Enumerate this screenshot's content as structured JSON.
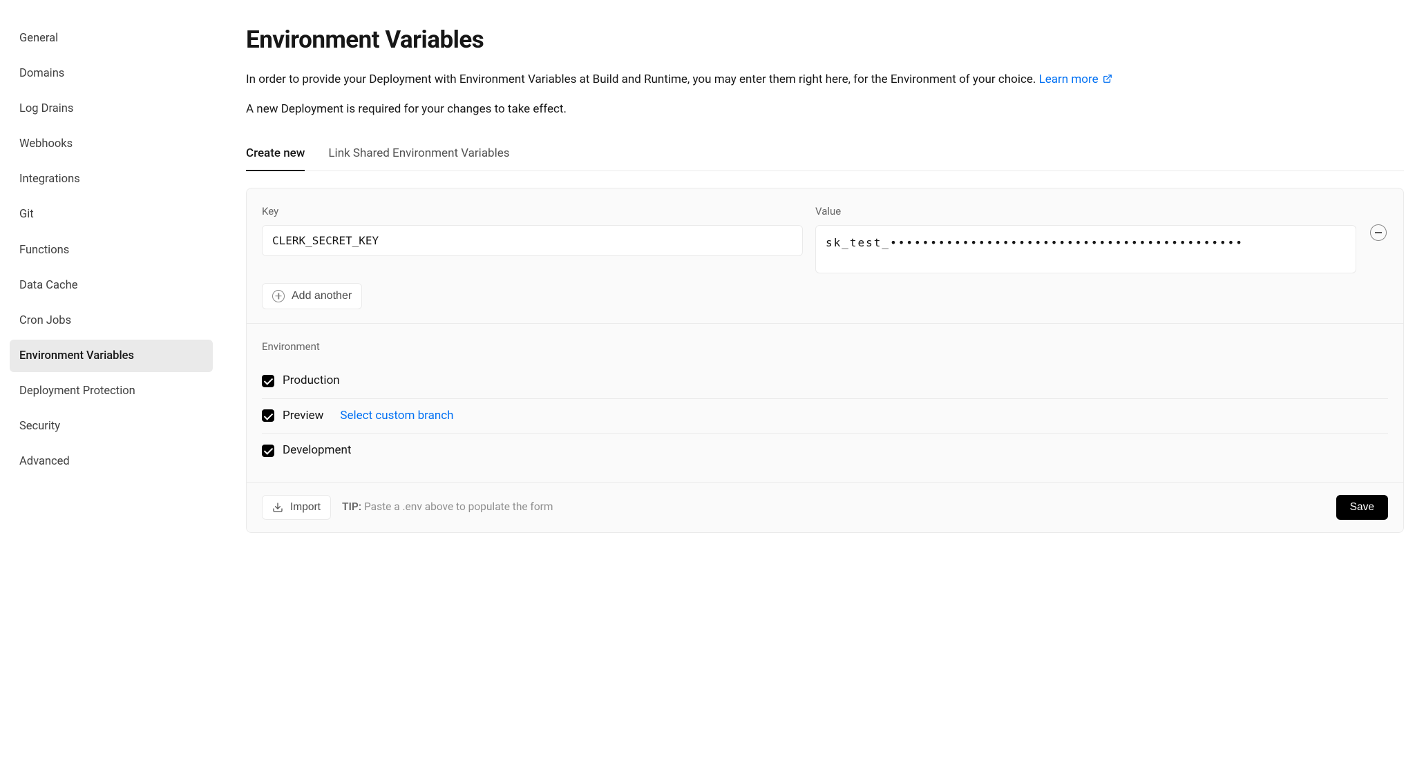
{
  "sidebar": {
    "items": [
      {
        "label": "General"
      },
      {
        "label": "Domains"
      },
      {
        "label": "Log Drains"
      },
      {
        "label": "Webhooks"
      },
      {
        "label": "Integrations"
      },
      {
        "label": "Git"
      },
      {
        "label": "Functions"
      },
      {
        "label": "Data Cache"
      },
      {
        "label": "Cron Jobs"
      },
      {
        "label": "Environment Variables",
        "active": true
      },
      {
        "label": "Deployment Protection"
      },
      {
        "label": "Security"
      },
      {
        "label": "Advanced"
      }
    ]
  },
  "header": {
    "title": "Environment Variables",
    "intro_prefix": "In order to provide your Deployment with Environment Variables at Build and Runtime, you may enter them right here, for the Environment of your choice. ",
    "learn_more": "Learn more",
    "note": "A new Deployment is required for your changes to take effect."
  },
  "tabs": [
    {
      "label": "Create new",
      "active": true
    },
    {
      "label": "Link Shared Environment Variables"
    }
  ],
  "form": {
    "key_label": "Key",
    "value_label": "Value",
    "key_value": "CLERK_SECRET_KEY",
    "value_display": "sk_test_••••••••••••••••••••••••••••••••••••••••••••",
    "add_another": "Add another"
  },
  "environment": {
    "section_label": "Environment",
    "rows": [
      {
        "label": "Production",
        "checked": true
      },
      {
        "label": "Preview",
        "checked": true,
        "branch_link": "Select custom branch"
      },
      {
        "label": "Development",
        "checked": true
      }
    ]
  },
  "footer": {
    "import": "Import",
    "tip_label": "TIP:",
    "tip_text": " Paste a .env above to populate the form",
    "save": "Save"
  }
}
